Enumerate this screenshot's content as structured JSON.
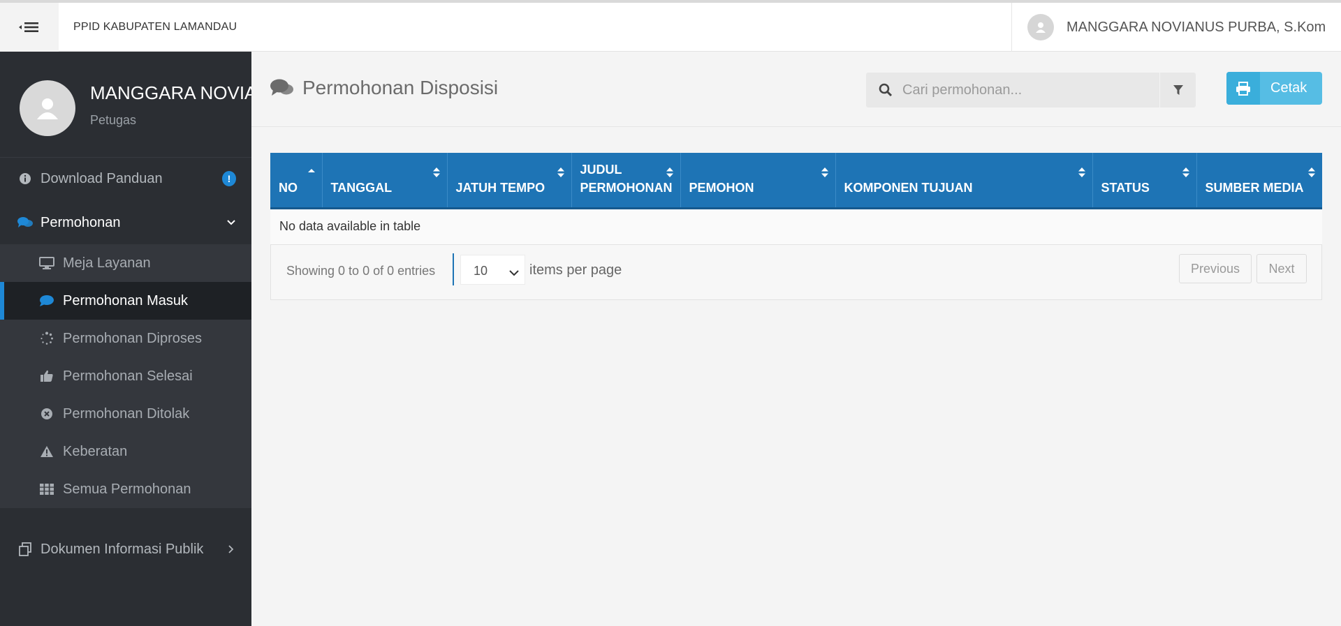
{
  "header": {
    "brand": "PPID KABUPATEN LAMANDAU",
    "user_name": "MANGGARA NOVIANUS PURBA, S.Kom"
  },
  "sidebar": {
    "profile": {
      "name": "MANGGARA NOVIANUS PURBA, S.Kom",
      "role": "Petugas"
    },
    "items": [
      {
        "label": "Download Panduan",
        "icon": "info-circle-icon",
        "badge": "!"
      },
      {
        "label": "Permohonan",
        "icon": "comments-icon",
        "expanded": true
      },
      {
        "label": "Dokumen Informasi Publik",
        "icon": "copy-icon"
      }
    ],
    "subitems": [
      {
        "label": "Meja Layanan",
        "icon": "desktop-icon"
      },
      {
        "label": "Permohonan Masuk",
        "icon": "comment-icon",
        "active": true
      },
      {
        "label": "Permohonan Diproses",
        "icon": "spinner-icon"
      },
      {
        "label": "Permohonan Selesai",
        "icon": "thumbs-up-icon"
      },
      {
        "label": "Permohonan Ditolak",
        "icon": "times-circle-icon"
      },
      {
        "label": "Keberatan",
        "icon": "warning-icon"
      },
      {
        "label": "Semua Permohonan",
        "icon": "grid-icon"
      }
    ]
  },
  "main": {
    "title": "Permohonan Disposisi",
    "search_placeholder": "Cari permohonan...",
    "print_label": "Cetak",
    "table": {
      "columns": [
        "NO",
        "TANGGAL",
        "JATUH TEMPO",
        "JUDUL PERMOHONAN",
        "PEMOHON",
        "KOMPONEN TUJUAN",
        "STATUS",
        "SUMBER MEDIA"
      ],
      "empty_message": "No data available in table"
    },
    "footer": {
      "info": "Showing 0 to 0 of 0 entries",
      "per_page_value": "10",
      "per_page_label": "items per page",
      "previous": "Previous",
      "next": "Next"
    }
  },
  "colors": {
    "sidebar_bg": "#2b2e33",
    "accent": "#1e74b5",
    "print_button": "#56bde4"
  }
}
